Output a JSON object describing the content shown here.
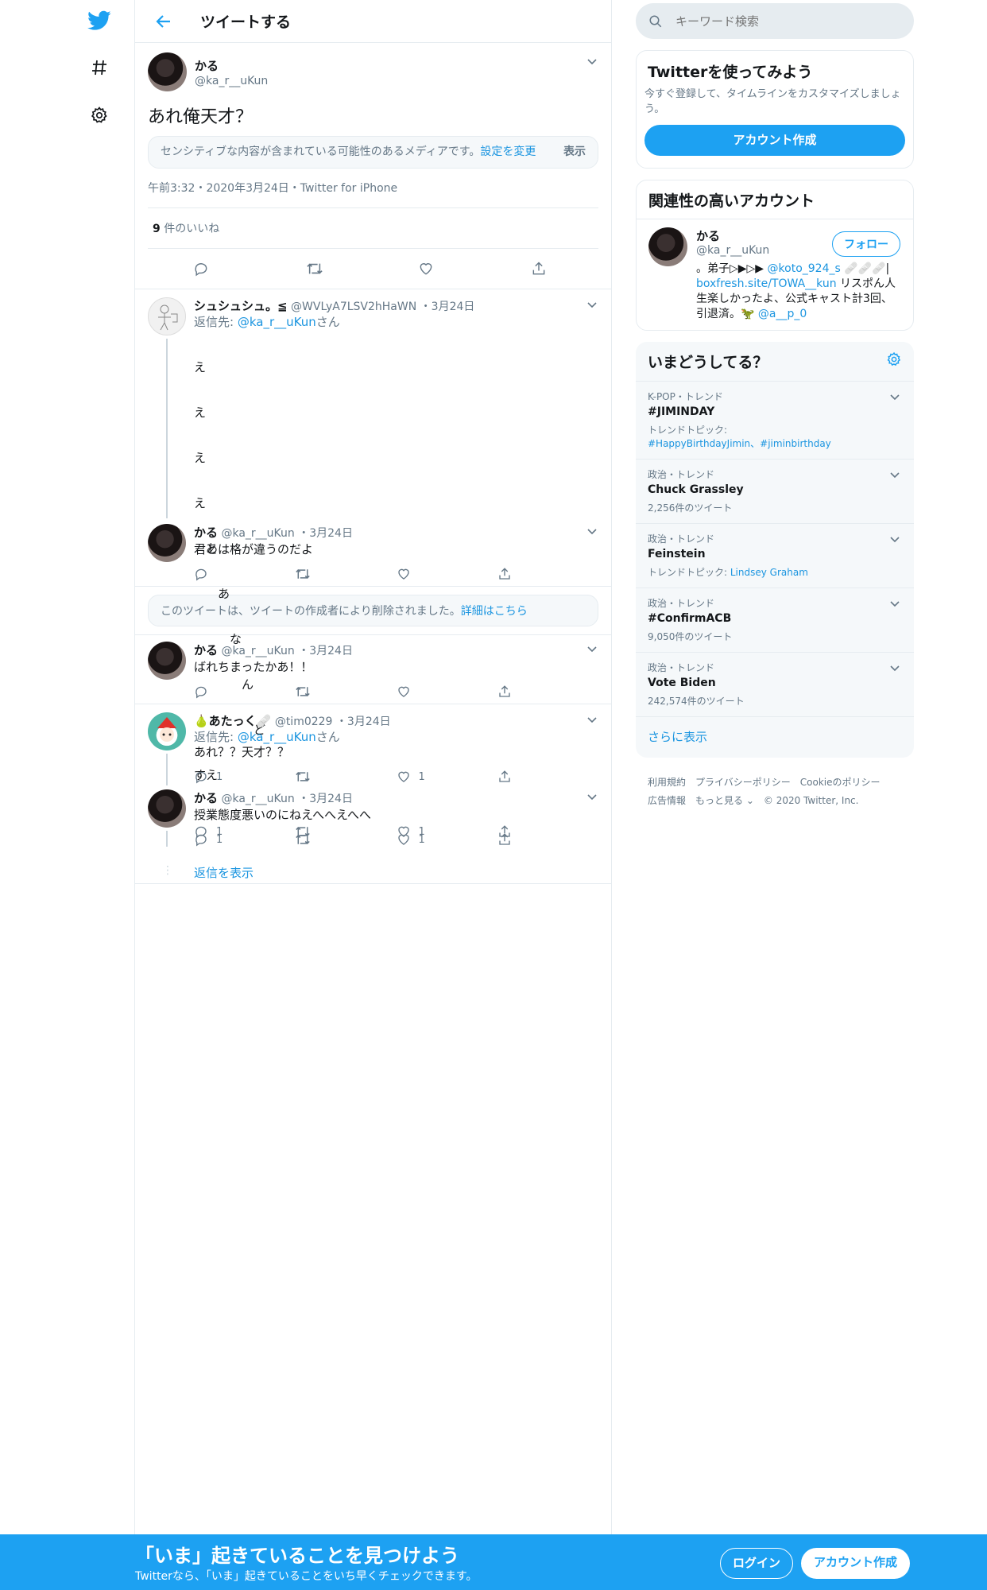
{
  "colors": {
    "accent": "#1da1f2",
    "link": "#1b95e0",
    "text": "#14171a",
    "muted": "#657786",
    "border": "#e6ecf0"
  },
  "nav": {
    "icons": [
      "twitter-bird-icon",
      "hashtag-icon",
      "gear-icon"
    ]
  },
  "header": {
    "title": "ツイートする"
  },
  "main_tweet": {
    "name": "かる",
    "handle": "@ka_r__uKun",
    "text": "あれ俺天才？",
    "sensitive_text": "センシティブな内容が含まれている可能性のあるメディアです。",
    "sensitive_link": "設定を変更",
    "sensitive_show": "表示",
    "meta": "午前3:32・2020年3月24日・Twitter for iPhone",
    "likes_count": "9",
    "likes_label": "件のいいね"
  },
  "replies": [
    {
      "name": "シュシュシュ。≦",
      "handle": "@WVLyA7LSV2hHaWN",
      "date": "・3月24日",
      "reply_to_label": "返信先:",
      "reply_to": "@ka_r__uKun",
      "reply_to_suffix": "さん",
      "lines": [
        "え",
        "え",
        "え",
        "え",
        "　あ",
        "　　あ",
        "　　　な",
        "　　　　ん",
        "　　　　　ど",
        "すえ"
      ],
      "reply_count": "1",
      "like_count": "1"
    },
    {
      "name": "かる",
      "handle": "@ka_r__uKun",
      "date": "・3月24日",
      "text": "君とは格が違うのだよ"
    },
    {
      "name": "かる",
      "handle": "@ka_r__uKun",
      "date": "・3月24日",
      "text": "ばれちまったかあ！！"
    },
    {
      "name": "🍐あたっく🩹",
      "handle": "@tim0229",
      "date": "・3月24日",
      "reply_to_label": "返信先:",
      "reply_to": "@ka_r__uKun",
      "reply_to_suffix": "さん",
      "text": "あれ？？天才？？",
      "reply_count": "1",
      "like_count": "1"
    },
    {
      "name": "かる",
      "handle": "@ka_r__uKun",
      "date": "・3月24日",
      "text": "授業態度悪いのにねえへへえへへ",
      "reply_count": "1",
      "like_count": "1"
    }
  ],
  "deleted_notice": {
    "text": "このツイートは、ツイートの作成者により削除されました。",
    "link": "詳細はこちら"
  },
  "show_replies": "返信を表示",
  "search": {
    "placeholder": "キーワード検索"
  },
  "signup_card": {
    "title": "Twitterを使ってみよう",
    "desc": "今すぐ登録して、タイムラインをカスタマイズしましょう。",
    "button": "アカウント作成"
  },
  "related": {
    "title": "関連性の高いアカウント",
    "name": "かる",
    "handle": "@ka_r__uKun",
    "follow": "フォロー",
    "bio_1": "。弟子▷▶▷▶ ",
    "bio_link1": "@koto_924_s",
    "bio_2": " 🩹🩹🩹| ",
    "bio_link2": "boxfresh.site/TOWA__kun",
    "bio_3": " リスポん人生楽しかったよ、公式キャスト計3回、引退済。🦖 ",
    "bio_link3": "@a__p_0"
  },
  "trends": {
    "title": "いまどうしてる？",
    "items": [
      {
        "category": "K-POP・トレンド",
        "name": "#JIMINDAY",
        "sub_label": "トレンドトピック:",
        "sub_links": "#HappyBirthdayJimin、#jiminbirthday"
      },
      {
        "category": "政治・トレンド",
        "name": "Chuck Grassley",
        "count": "2,256件のツイート"
      },
      {
        "category": "政治・トレンド",
        "name": "Feinstein",
        "sub_label": "トレンドトピック: ",
        "sub_links": "Lindsey Graham"
      },
      {
        "category": "政治・トレンド",
        "name": "#ConfirmACB",
        "count": "9,050件のツイート"
      },
      {
        "category": "政治・トレンド",
        "name": "Vote Biden",
        "count": "242,574件のツイート"
      }
    ],
    "more": "さらに表示"
  },
  "footer": {
    "links": [
      "利用規約",
      "プライバシーポリシー",
      "Cookieのポリシー",
      "広告情報",
      "もっと見る ⌄"
    ],
    "copyright": "© 2020 Twitter, Inc."
  },
  "bottom_bar": {
    "title": "「いま」起きていることを見つけよう",
    "subtitle": "Twitterなら、「いま」起きていることをいち早くチェックできます。",
    "login": "ログイン",
    "signup": "アカウント作成"
  }
}
